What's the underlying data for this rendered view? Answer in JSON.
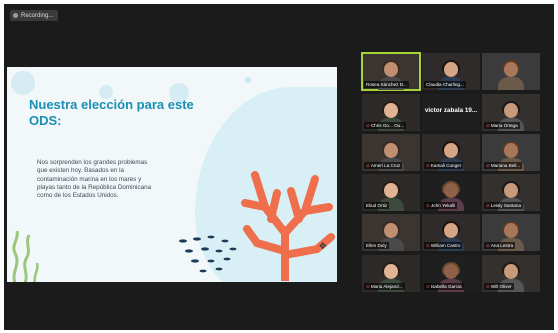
{
  "recording": {
    "label": "Recording..."
  },
  "slide": {
    "title": "Nuestra elección para este ODS:",
    "body": "Nos sorprenden los grandes problemas que existen hoy. Basados en la contaminación marina en los mares y playas tanto de la República Dominicana como de los Estados Unidos."
  },
  "colors": {
    "slide_title": "#1a8fb3",
    "coral": "#ef6f4c",
    "active_speaker_border": "#a7d33a",
    "background": "#1b1b1b"
  },
  "participants": [
    {
      "name": "Rosea Sánchez D...",
      "muted": false,
      "active": true,
      "video": true
    },
    {
      "name": "Claudia Charling...",
      "muted": false,
      "active": false,
      "video": true
    },
    {
      "name": "",
      "muted": false,
      "active": false,
      "video": true
    },
    {
      "name": "Chris Go... Ou...",
      "muted": true,
      "active": false,
      "video": true
    },
    {
      "name": "",
      "muted": false,
      "active": false,
      "video": false,
      "display_text": "victor zabala 19..."
    },
    {
      "name": "Maria Ortega",
      "muted": true,
      "active": false,
      "video": true
    },
    {
      "name": "Ameri La Cruz",
      "muted": true,
      "active": false,
      "video": true
    },
    {
      "name": "Kamali Cunger",
      "muted": true,
      "active": false,
      "video": true
    },
    {
      "name": "Mariana Bell...",
      "muted": true,
      "active": false,
      "video": true
    },
    {
      "name": "Eliud Ortiz",
      "muted": false,
      "active": false,
      "video": true
    },
    {
      "name": "John Yekalli",
      "muted": true,
      "active": false,
      "video": true
    },
    {
      "name": "Leisly Santana",
      "muted": true,
      "active": false,
      "video": true
    },
    {
      "name": "Ellen Duly",
      "muted": false,
      "active": false,
      "video": true
    },
    {
      "name": "William Castro",
      "muted": true,
      "active": false,
      "video": true
    },
    {
      "name": "Ana Lestra",
      "muted": true,
      "active": false,
      "video": true
    },
    {
      "name": "Maria Alejand...",
      "muted": true,
      "active": false,
      "video": true
    },
    {
      "name": "Isabella Garcia",
      "muted": true,
      "active": false,
      "video": true
    },
    {
      "name": "Will Oliver",
      "muted": true,
      "active": false,
      "video": true
    }
  ]
}
